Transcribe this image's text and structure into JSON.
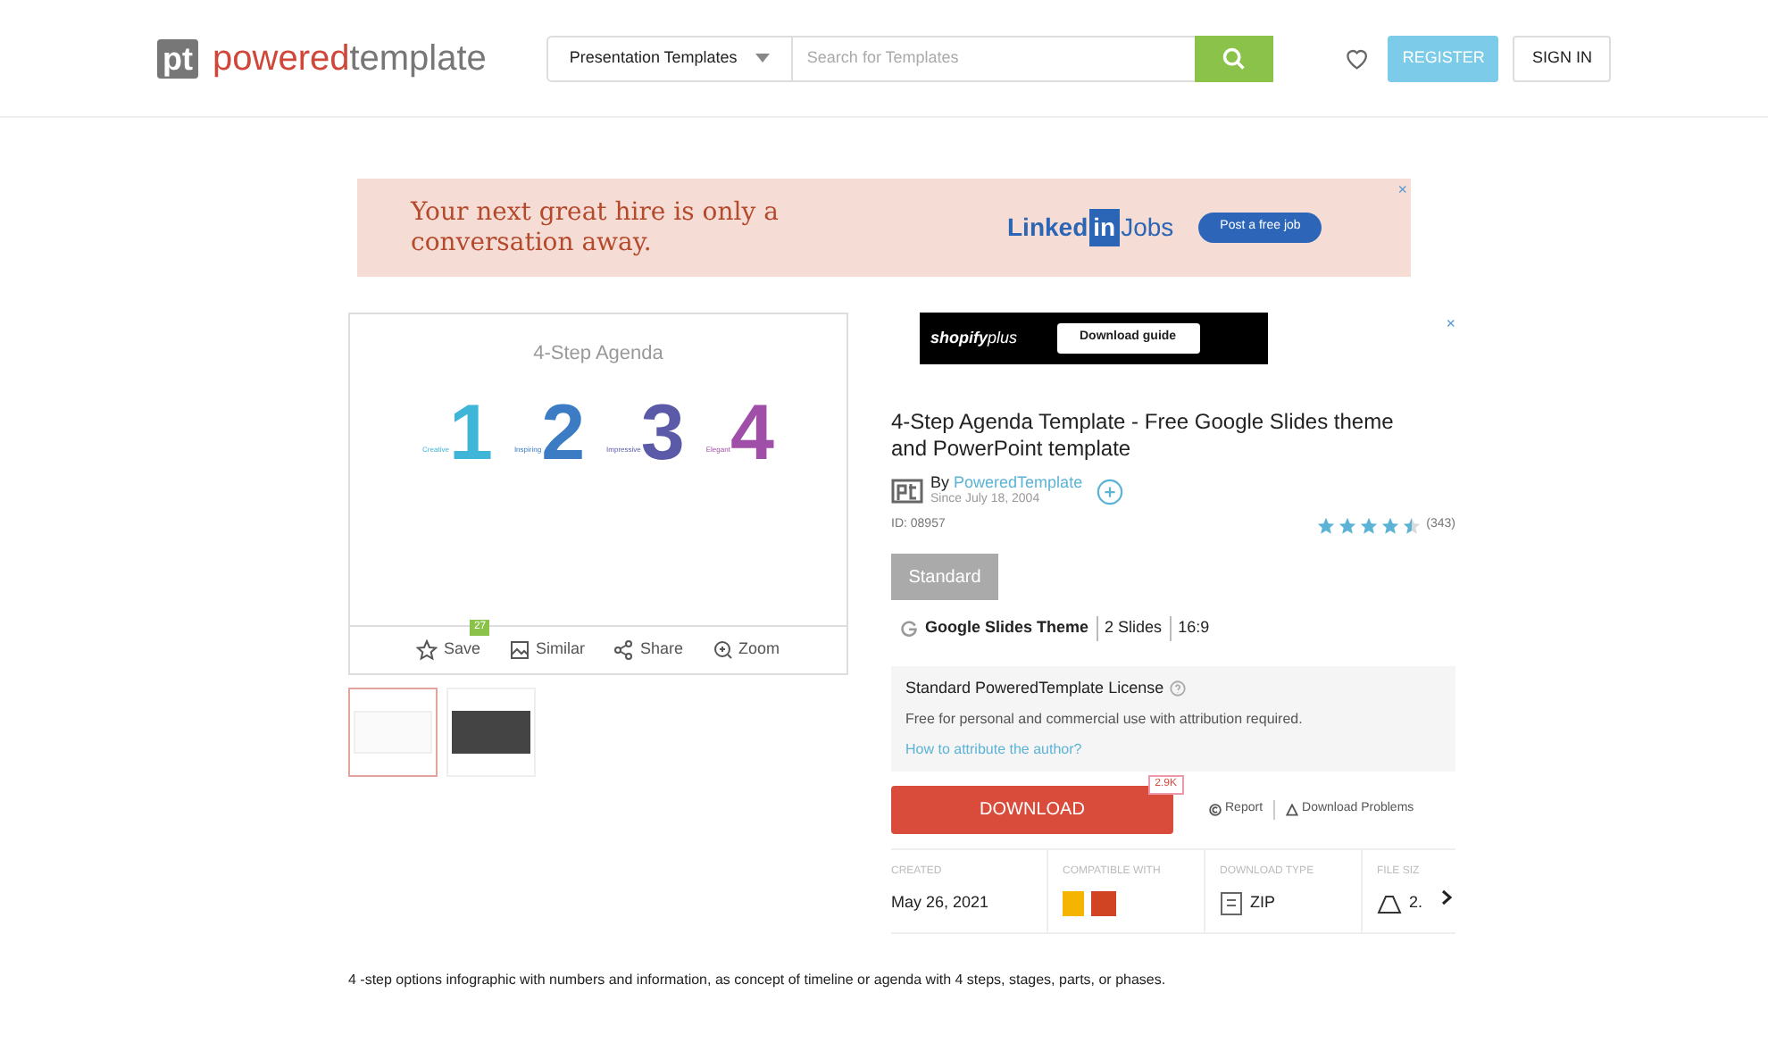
{
  "header": {
    "logo_mark": "pt",
    "logo_brand": "powered",
    "logo_rest": "template",
    "category": "Presentation Templates",
    "search": {
      "placeholder": "Search for Templates"
    },
    "register": "REGISTER",
    "sign_in": "SIGN IN"
  },
  "ad_banner": {
    "headline": "Your next great hire is only a conversation away.",
    "brand_word": "Linked",
    "brand_box": "in",
    "brand_tail": "Jobs",
    "cta": "Post a free job",
    "close": "×"
  },
  "preview": {
    "slide": {
      "title": "4-Step Agenda",
      "steps": [
        {
          "number": "1",
          "label": "Creative",
          "color": "#3fb5d8"
        },
        {
          "number": "2",
          "label": "Inspiring",
          "color": "#3b7cc4"
        },
        {
          "number": "3",
          "label": "Impressive",
          "color": "#5a5aa8"
        },
        {
          "number": "4",
          "label": "Elegant",
          "color": "#a04fa8"
        }
      ]
    },
    "actions": [
      {
        "kind": "save",
        "label": "Save",
        "badge": "27"
      },
      {
        "kind": "similar",
        "label": "Similar"
      },
      {
        "kind": "share",
        "label": "Share"
      },
      {
        "kind": "zoom",
        "label": "Zoom"
      }
    ],
    "thumbnails": [
      {
        "dark": false,
        "selected": true
      },
      {
        "dark": true,
        "selected": false
      }
    ]
  },
  "side_ad": {
    "brand": "shopify",
    "brand_tail": "plus",
    "cta": "Download guide",
    "close": "×"
  },
  "product": {
    "title": "4-Step Agenda Template - Free Google Slides theme and PowerPoint template",
    "by": "By",
    "author": "PoweredTemplate",
    "since": "Since July 18, 2004",
    "id": "ID: 08957",
    "stars": 4.5,
    "rating_count": "(343)",
    "plan": "Standard",
    "formats": [
      "Google Slides Theme",
      "2 Slides",
      "16:9"
    ],
    "license": {
      "title": "Standard PoweredTemplate License",
      "text": "Free for personal and commercial use with attribution required.",
      "link": "How to attribute the author?"
    },
    "download": "DOWNLOAD",
    "download_count": "2.9K",
    "report": "Report",
    "problems": "Download Problems",
    "info": [
      {
        "kind": "created",
        "label": "CREATED",
        "value": "May 26, 2021"
      },
      {
        "kind": "compatible",
        "label": "COMPATIBLE WITH"
      },
      {
        "kind": "type",
        "label": "DOWNLOAD TYPE",
        "value": "ZIP"
      },
      {
        "kind": "size",
        "label": "FILE SIZ",
        "value": "2."
      }
    ]
  },
  "description": "4 -step options infographic with numbers and information, as concept of timeline or agenda with 4 steps, stages, parts, or phases."
}
